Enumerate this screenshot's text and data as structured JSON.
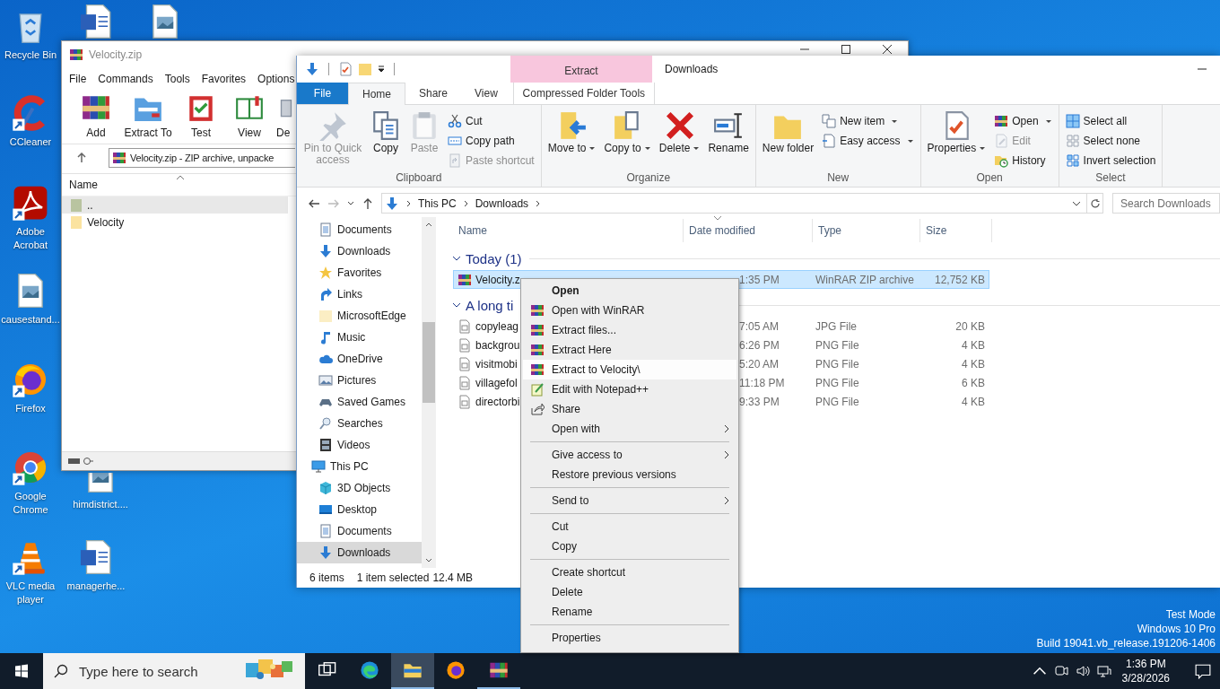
{
  "desktop": {
    "icons": [
      {
        "kind": "recycle",
        "shortcut": false,
        "label": "Recycle Bin"
      },
      {
        "kind": "word",
        "shortcut": false
      },
      {
        "kind": "image",
        "shortcut": false
      },
      {
        "kind": "ccleaner",
        "shortcut": true,
        "label": "CCleaner"
      },
      {
        "kind": "acrobat",
        "shortcut": true,
        "label": "Adobe Acrobat"
      },
      {
        "kind": "image",
        "shortcut": false,
        "label": "causestand..."
      },
      {
        "kind": "firefox",
        "shortcut": true,
        "label": "Firefox"
      },
      {
        "kind": "chrome",
        "shortcut": true,
        "label": "Google Chrome"
      },
      {
        "kind": "image",
        "shortcut": false,
        "label": "himdistrict...."
      },
      {
        "kind": "vlc",
        "shortcut": true,
        "label": "VLC media player"
      },
      {
        "kind": "word",
        "shortcut": false,
        "label": "managerhe..."
      }
    ],
    "system_info": [
      "Test Mode",
      "Windows 10 Pro",
      "Build 19041.vb_release.191206-1406"
    ]
  },
  "winrar": {
    "title": "Velocity.zip",
    "menu": [
      "File",
      "Commands",
      "Tools",
      "Favorites",
      "Options"
    ],
    "toolbar": [
      {
        "label": "Add"
      },
      {
        "label": "Extract To"
      },
      {
        "label": "Test"
      },
      {
        "label": "View"
      },
      {
        "label": "De"
      }
    ],
    "path": "Velocity.zip - ZIP archive, unpacke",
    "column": "Name",
    "rows": [
      {
        "name": "..",
        "kind": "parent",
        "selected": true
      },
      {
        "name": "Velocity",
        "kind": "folder",
        "selected": false
      }
    ]
  },
  "explorer": {
    "title": "Downloads",
    "context_tab": {
      "group": "Extract",
      "label": "Compressed Folder Tools",
      "selected": false
    },
    "tabs": [
      {
        "label": "File",
        "kind": "file",
        "selected": false
      },
      {
        "label": "Home",
        "kind": "tab",
        "selected": true
      },
      {
        "label": "Share",
        "kind": "tab",
        "selected": false
      },
      {
        "label": "View",
        "kind": "tab",
        "selected": false
      }
    ],
    "ribbon": [
      {
        "label": "Clipboard",
        "items": [
          {
            "label": "Pin to Quick access",
            "kind": "large",
            "disabled": true,
            "dropdown": false
          },
          {
            "label": "Copy",
            "kind": "large",
            "disabled": false,
            "dropdown": false
          },
          {
            "label": "Paste",
            "kind": "large",
            "disabled": true,
            "dropdown": false
          },
          {
            "label": "Cut",
            "kind": "small",
            "disabled": false,
            "dropdown": false
          },
          {
            "label": "Copy path",
            "kind": "small",
            "disabled": false,
            "dropdown": false
          },
          {
            "label": "Paste shortcut",
            "kind": "small",
            "disabled": true,
            "dropdown": false
          }
        ]
      },
      {
        "label": "Organize",
        "items": [
          {
            "label": "Move to",
            "kind": "large",
            "disabled": false,
            "dropdown": true
          },
          {
            "label": "Copy to",
            "kind": "large",
            "disabled": false,
            "dropdown": true
          },
          {
            "label": "Delete",
            "kind": "large",
            "disabled": false,
            "dropdown": true
          },
          {
            "label": "Rename",
            "kind": "large",
            "disabled": false,
            "dropdown": false
          }
        ]
      },
      {
        "label": "New",
        "items": [
          {
            "label": "New folder",
            "kind": "large",
            "disabled": false,
            "dropdown": false
          },
          {
            "label": "New item",
            "kind": "small",
            "disabled": false,
            "dropdown": true
          },
          {
            "label": "Easy access",
            "kind": "small",
            "disabled": false,
            "dropdown": true
          }
        ]
      },
      {
        "label": "Open",
        "items": [
          {
            "label": "Properties",
            "kind": "large",
            "disabled": false,
            "dropdown": true
          },
          {
            "label": "Open",
            "kind": "small",
            "disabled": false,
            "dropdown": true
          },
          {
            "label": "Edit",
            "kind": "small",
            "disabled": true,
            "dropdown": false
          },
          {
            "label": "History",
            "kind": "small",
            "disabled": false,
            "dropdown": false
          }
        ]
      },
      {
        "label": "Select",
        "items": [
          {
            "label": "Select all",
            "kind": "small",
            "disabled": false,
            "dropdown": false
          },
          {
            "label": "Select none",
            "kind": "small",
            "disabled": false,
            "dropdown": false
          },
          {
            "label": "Invert selection",
            "kind": "small",
            "disabled": false,
            "dropdown": false
          }
        ]
      }
    ],
    "breadcrumb": [
      "This PC",
      "Downloads"
    ],
    "search": {
      "placeholder": "Search Downloads"
    },
    "nav_tree": [
      {
        "children": [
          {
            "label": "Documents",
            "selected": false
          },
          {
            "label": "Downloads",
            "selected": false
          },
          {
            "label": "Favorites",
            "selected": false
          },
          {
            "label": "Links",
            "selected": false
          },
          {
            "label": "MicrosoftEdge",
            "selected": false
          },
          {
            "label": "Music",
            "selected": false
          },
          {
            "label": "OneDrive",
            "selected": false
          },
          {
            "label": "Pictures",
            "selected": false
          },
          {
            "label": "Saved Games",
            "selected": false
          },
          {
            "label": "Searches",
            "selected": false
          },
          {
            "label": "Videos",
            "selected": false
          }
        ]
      },
      {
        "label": "This PC",
        "selected": false,
        "children": [
          {
            "label": "3D Objects",
            "selected": false
          },
          {
            "label": "Desktop",
            "selected": false
          },
          {
            "label": "Documents",
            "selected": false
          },
          {
            "label": "Downloads",
            "selected": true
          }
        ]
      }
    ],
    "columns": [
      {
        "label": "Name",
        "sorted": false
      },
      {
        "label": "Date modified",
        "sorted": true
      },
      {
        "label": "Type",
        "sorted": false
      },
      {
        "label": "Size",
        "sorted": false
      }
    ],
    "groups": [
      {
        "title": "Today (1)",
        "expanded": true,
        "rows": [
          {
            "name": "Velocity.z",
            "kind": "archive",
            "date": "1:35 PM",
            "type": "WinRAR ZIP archive",
            "size": "12,752 KB",
            "selected": true
          }
        ]
      },
      {
        "title": "A long ti",
        "expanded": true,
        "rows": [
          {
            "name": "copyleag",
            "kind": "image",
            "date": "7:05 AM",
            "type": "JPG File",
            "size": "20 KB",
            "selected": false
          },
          {
            "name": "backgrou",
            "kind": "image",
            "date": "6:26 PM",
            "type": "PNG File",
            "size": "4 KB",
            "selected": false
          },
          {
            "name": "visitmobi",
            "kind": "image",
            "date": "5:20 AM",
            "type": "PNG File",
            "size": "4 KB",
            "selected": false
          },
          {
            "name": "villagefol",
            "kind": "image",
            "date": "11:18 PM",
            "type": "PNG File",
            "size": "6 KB",
            "selected": false
          },
          {
            "name": "directorbi",
            "kind": "image",
            "date": "9:33 PM",
            "type": "PNG File",
            "size": "4 KB",
            "selected": false
          }
        ]
      }
    ],
    "status": {
      "count": "6 items",
      "selection": "1 item selected",
      "size": "12.4 MB"
    }
  },
  "context_menu": {
    "items": [
      {
        "label": "Open",
        "kind": "default",
        "selected": false
      },
      {
        "label": "Open with WinRAR",
        "kind": "archive",
        "selected": false
      },
      {
        "label": "Extract files...",
        "kind": "archive",
        "selected": false
      },
      {
        "label": "Extract Here",
        "kind": "archive",
        "selected": false
      },
      {
        "label": "Extract to Velocity\\",
        "kind": "archive",
        "selected": true
      },
      {
        "label": "Edit with Notepad++",
        "kind": "editor",
        "selected": false
      },
      {
        "label": "Share",
        "kind": "share",
        "selected": false
      },
      {
        "label": "Open with",
        "kind": "submenu",
        "selected": false
      },
      {
        "kind": "separator"
      },
      {
        "label": "Give access to",
        "kind": "submenu",
        "selected": false
      },
      {
        "label": "Restore previous versions",
        "kind": "plain",
        "selected": false
      },
      {
        "kind": "separator"
      },
      {
        "label": "Send to",
        "kind": "submenu",
        "selected": false
      },
      {
        "kind": "separator"
      },
      {
        "label": "Cut",
        "kind": "plain",
        "selected": false
      },
      {
        "label": "Copy",
        "kind": "plain",
        "selected": false
      },
      {
        "kind": "separator"
      },
      {
        "label": "Create shortcut",
        "kind": "plain",
        "selected": false
      },
      {
        "label": "Delete",
        "kind": "plain",
        "selected": false
      },
      {
        "label": "Rename",
        "kind": "plain",
        "selected": false
      },
      {
        "kind": "separator"
      },
      {
        "label": "Properties",
        "kind": "plain",
        "selected": false
      }
    ]
  },
  "taskbar": {
    "search": {
      "placeholder": "Type here to search"
    },
    "apps": [
      {
        "kind": "taskview",
        "selected": false,
        "running": false
      },
      {
        "kind": "edge",
        "selected": false,
        "running": false
      },
      {
        "kind": "explorer",
        "selected": true,
        "running": true
      },
      {
        "kind": "firefox",
        "selected": false,
        "running": false
      },
      {
        "kind": "winrar",
        "selected": false,
        "running": true
      }
    ],
    "time": "1:36 PM",
    "date": "3/28/2026"
  }
}
